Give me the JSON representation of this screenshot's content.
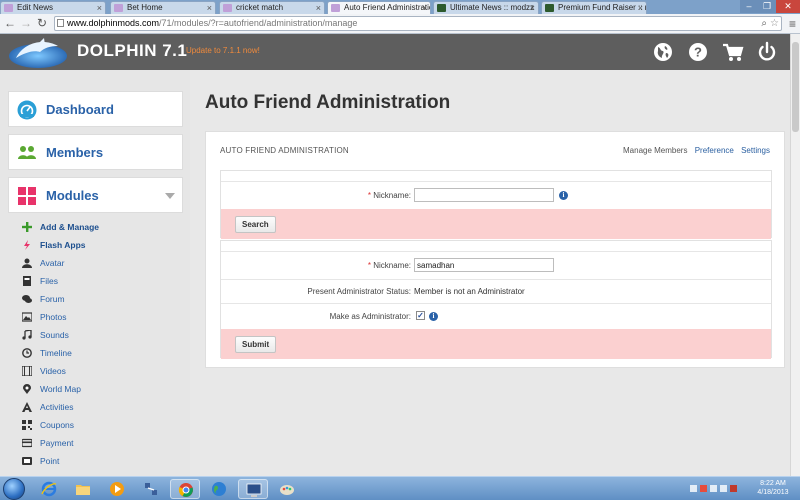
{
  "browser": {
    "tabs": [
      {
        "title": "Edit News",
        "active": false
      },
      {
        "title": "Bet Home",
        "active": false
      },
      {
        "title": "cricket match",
        "active": false
      },
      {
        "title": "Auto Friend Administratio",
        "active": true
      },
      {
        "title": "Ultimate News :: modzz",
        "active": false
      },
      {
        "title": "Premium Fund Raiser :: m",
        "active": false
      }
    ],
    "url_host": "www.dolphinmods.com",
    "url_path": "/71/modules/?r=autofriend/administration/manage"
  },
  "header": {
    "brand": "DOLPHIN 7.1",
    "update_notice": "Update to 7.1.1 now!",
    "icons": [
      "globe-icon",
      "help-icon",
      "cart-icon",
      "power-icon"
    ]
  },
  "sidebar": {
    "cards": [
      {
        "label": "Dashboard",
        "icon": "dashboard-icon"
      },
      {
        "label": "Members",
        "icon": "members-icon"
      },
      {
        "label": "Modules",
        "icon": "modules-icon"
      }
    ],
    "module_items": [
      {
        "label": "Add & Manage",
        "icon": "plus-icon",
        "bold": true
      },
      {
        "label": "Flash Apps",
        "icon": "flash-icon",
        "bold": true
      },
      {
        "label": "Avatar",
        "icon": "user-icon",
        "bold": false
      },
      {
        "label": "Files",
        "icon": "file-icon",
        "bold": false
      },
      {
        "label": "Forum",
        "icon": "chat-icon",
        "bold": false
      },
      {
        "label": "Photos",
        "icon": "photo-icon",
        "bold": false
      },
      {
        "label": "Sounds",
        "icon": "music-icon",
        "bold": false
      },
      {
        "label": "Timeline",
        "icon": "clock-icon",
        "bold": false
      },
      {
        "label": "Videos",
        "icon": "film-icon",
        "bold": false
      },
      {
        "label": "World Map",
        "icon": "map-pin-icon",
        "bold": false
      },
      {
        "label": "Activities",
        "icon": "activities-icon",
        "bold": false
      },
      {
        "label": "Coupons",
        "icon": "qr-icon",
        "bold": false
      },
      {
        "label": "Payment",
        "icon": "card-icon",
        "bold": false
      },
      {
        "label": "Point",
        "icon": "point-icon",
        "bold": false
      }
    ]
  },
  "main": {
    "page_title": "Auto Friend Administration",
    "panel_title": "AUTO FRIEND ADMINISTRATION",
    "panel_links": [
      {
        "label": "Manage Members",
        "current": true
      },
      {
        "label": "Preference",
        "current": false
      },
      {
        "label": "Settings",
        "current": false
      }
    ],
    "search_form": {
      "nickname_label": "Nickname:",
      "nickname_value": "",
      "search_button": "Search"
    },
    "admin_form": {
      "nickname_label": "Nickname:",
      "nickname_value": "samadhan",
      "status_label": "Present Administrator Status:",
      "status_value": "Member is not an Administrator",
      "make_admin_label": "Make as Administrator:",
      "make_admin_checked": true,
      "submit_button": "Submit"
    }
  },
  "taskbar": {
    "time": "8:22 AM",
    "date": "4/18/2013"
  },
  "colors": {
    "header_bg": "#5e5e5e",
    "accent_blue": "#2a62a8",
    "update_orange": "#f08a3c",
    "form_pink": "#fbd0d0",
    "modules_red": "#e8336a",
    "members_green": "#5aa832"
  }
}
